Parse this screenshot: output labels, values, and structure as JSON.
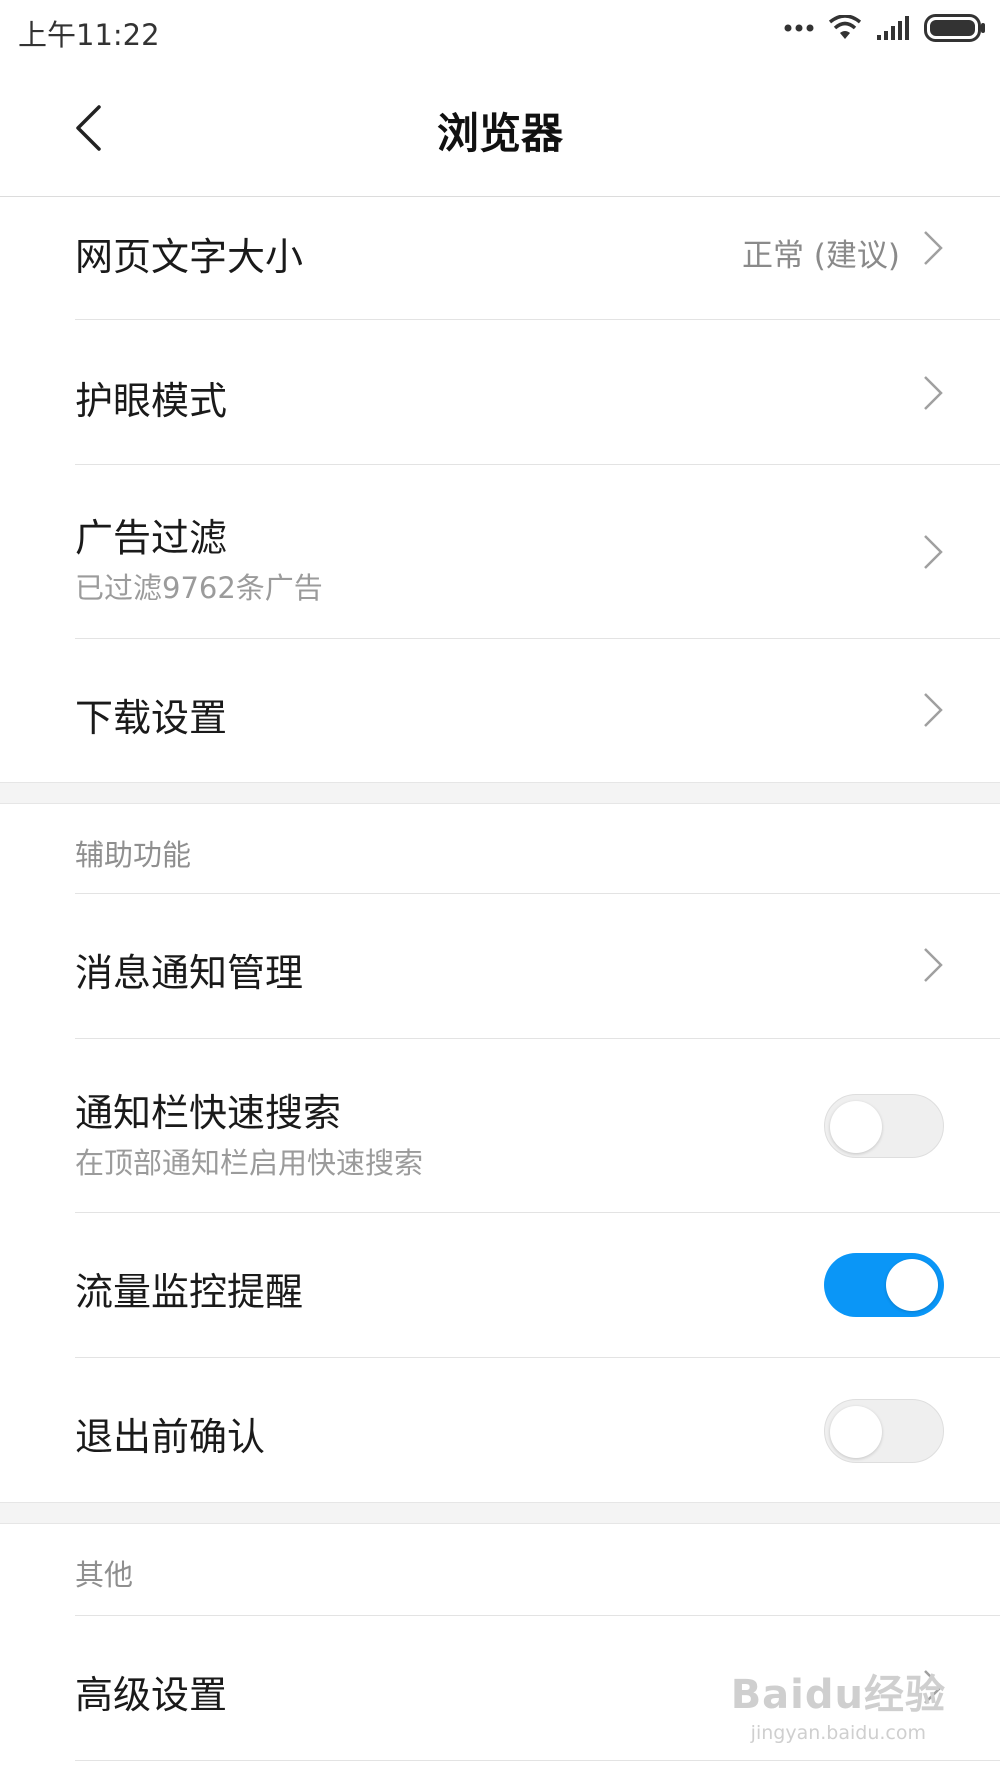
{
  "status_bar": {
    "time": "上午11:22"
  },
  "header": {
    "title": "浏览器"
  },
  "rows_top": [
    {
      "label": "网页文字大小",
      "value": "正常 (建议)"
    },
    {
      "label": "护眼模式"
    },
    {
      "label": "广告过滤",
      "sub": "已过滤9762条广告"
    },
    {
      "label": "下载设置"
    }
  ],
  "section_assist": {
    "heading": "辅助功能",
    "items": [
      {
        "label": "消息通知管理"
      },
      {
        "label": "通知栏快速搜索",
        "sub": "在顶部通知栏启用快速搜索",
        "toggle": "off"
      },
      {
        "label": "流量监控提醒",
        "toggle": "on"
      },
      {
        "label": "退出前确认",
        "toggle": "off"
      }
    ]
  },
  "section_other": {
    "heading": "其他",
    "items": [
      {
        "label": "高级设置"
      }
    ]
  },
  "watermark": {
    "main": "Baidu经验",
    "sub": "jingyan.baidu.com"
  },
  "colors": {
    "accent": "#0a96f7",
    "toggle_off": "#efefef",
    "divider": "#e3e3e3",
    "section_bg": "#f4f4f4"
  },
  "icons": [
    "back-arrow-icon",
    "chevron-right-icon",
    "more-dots-icon",
    "wifi-icon",
    "signal-icon",
    "battery-icon"
  ]
}
